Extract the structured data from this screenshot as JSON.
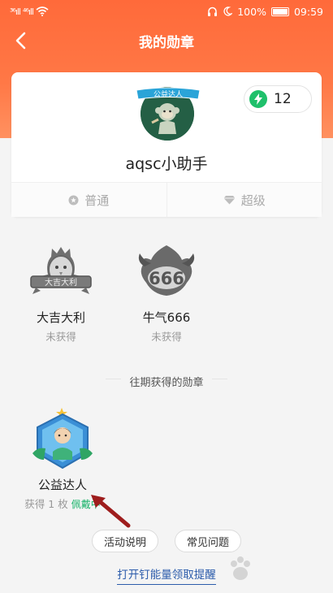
{
  "status_bar": {
    "signal_1": "³⁶ıll",
    "signal_2": "⁴⁶ıll",
    "battery_percent": "100%",
    "time": "09:59"
  },
  "nav": {
    "title": "我的勋章"
  },
  "profile": {
    "banner_text": "公益达人",
    "username": "aqsc小助手",
    "energy_count": "12",
    "level_tabs": [
      "普通",
      "超级"
    ]
  },
  "current_badges": [
    {
      "name": "大吉大利",
      "status": "未获得",
      "emblem_text": "大吉大利"
    },
    {
      "name": "牛气666",
      "status": "未获得",
      "emblem_text": "666"
    }
  ],
  "past_section": {
    "title": "往期获得的勋章"
  },
  "past_badges": [
    {
      "name": "公益达人",
      "status": "获得 1 枚",
      "wearing_label": "佩戴中"
    }
  ],
  "buttons": {
    "activity_desc": "活动说明",
    "faq": "常见问题"
  },
  "reminder_link": "打开钉能量领取提醒",
  "colors": {
    "header_orange": "#ff6a3a",
    "energy_green": "#1fc06b",
    "wearing_green": "#19b36a",
    "link_blue": "#2c5cab",
    "arrow_red": "#9e1d1d"
  }
}
